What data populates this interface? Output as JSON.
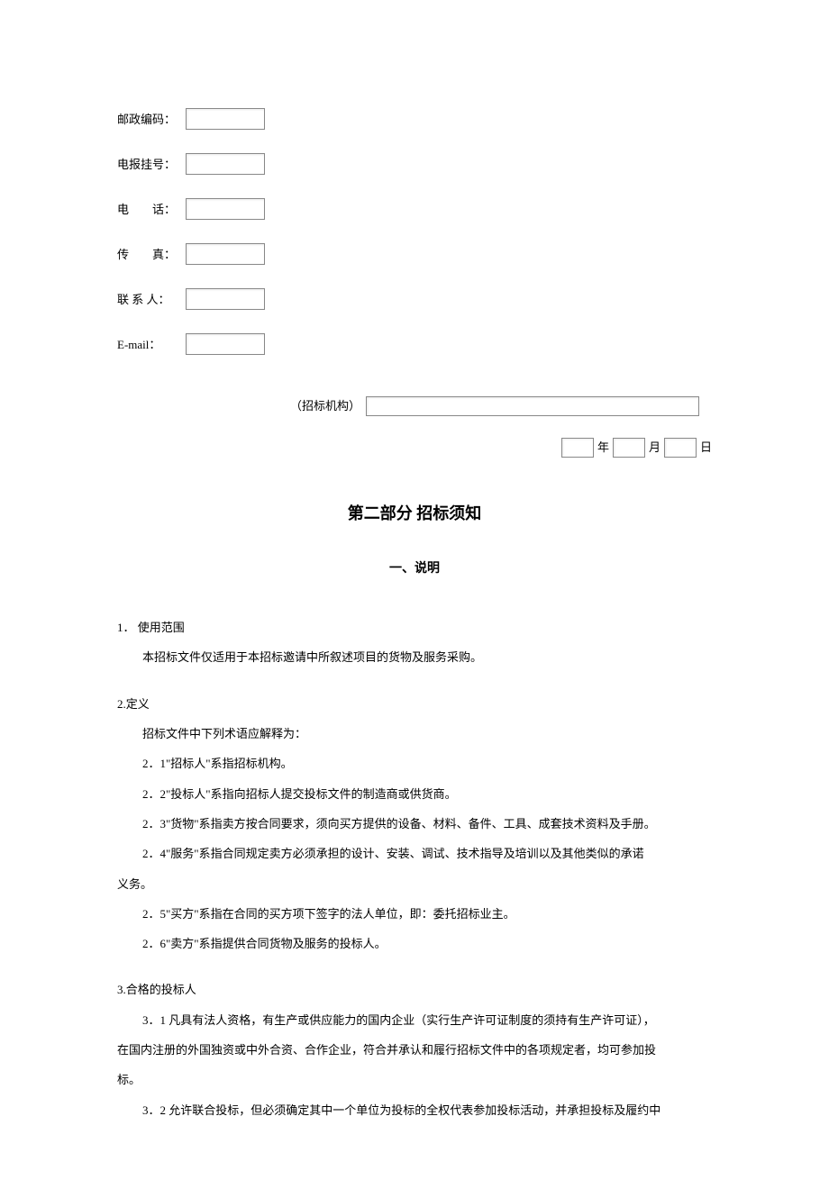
{
  "fields": {
    "postal_code": {
      "label": "邮政编码："
    },
    "telex": {
      "label": "电报挂号："
    },
    "phone": {
      "label": "电　　话："
    },
    "fax": {
      "label": "传　　真："
    },
    "contact": {
      "label": "联 系 人："
    },
    "email": {
      "label": "E-mail："
    }
  },
  "org": {
    "label": "（招标机构）"
  },
  "date": {
    "year_suffix": "年",
    "month_suffix": "月",
    "day_suffix": "日"
  },
  "section_title": "第二部分 招标须知",
  "sub_title": "一、说明",
  "clause1": {
    "header": "1． 使用范围",
    "p1": "本招标文件仅适用于本招标邀请中所叙述项目的货物及服务采购。"
  },
  "clause2": {
    "header": "2.定义",
    "p1": "招标文件中下列术语应解释为：",
    "p2": "2．1\"招标人\"系指招标机构。",
    "p3": "2．2\"投标人\"系指向招标人提交投标文件的制造商或供货商。",
    "p4": "2．3\"货物\"系指卖方按合同要求，须向买方提供的设备、材料、备件、工具、成套技术资料及手册。",
    "p5": "2．4\"服务\"系指合同规定卖方必须承担的设计、安装、调试、技术指导及培训以及其他类似的承诺",
    "p5b": "义务。",
    "p6": "2．5\"买方\"系指在合同的买方项下签字的法人单位，即：委托招标业主。",
    "p7": "2．6\"卖方\"系指提供合同货物及服务的投标人。"
  },
  "clause3": {
    "header": "3.合格的投标人",
    "p1": "3．1 凡具有法人资格，有生产或供应能力的国内企业（实行生产许可证制度的须持有生产许可证），",
    "p1b": "在国内注册的外国独资或中外合资、合作企业，符合并承认和履行招标文件中的各项规定者，均可参加投",
    "p1c": "标。",
    "p2": "3．2 允许联合投标，但必须确定其中一个单位为投标的全权代表参加投标活动，并承担投标及履约中"
  }
}
